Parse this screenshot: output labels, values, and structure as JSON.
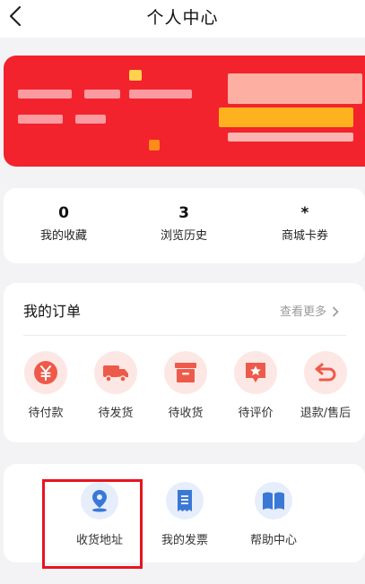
{
  "header": {
    "title": "个人中心"
  },
  "colors": {
    "accent": "#f2232d",
    "order_icon_bg": "#fde7e4",
    "order_icon": "#ee5a4a",
    "tool_icon_bg": "#e6eefb",
    "tool_icon": "#3a78d6"
  },
  "stats": [
    {
      "value": "0",
      "label": "我的收藏"
    },
    {
      "value": "3",
      "label": "浏览历史"
    },
    {
      "value": "*",
      "label": "商城卡券"
    }
  ],
  "orders": {
    "title": "我的订单",
    "more_label": "查看更多",
    "items": [
      {
        "label": "待付款",
        "icon": "yuan-icon"
      },
      {
        "label": "待发货",
        "icon": "truck-icon"
      },
      {
        "label": "待收货",
        "icon": "box-icon"
      },
      {
        "label": "待评价",
        "icon": "star-comment-icon"
      },
      {
        "label": "退款/售后",
        "icon": "return-arrow-icon"
      }
    ]
  },
  "tools": [
    {
      "label": "收货地址",
      "icon": "location-pin-icon"
    },
    {
      "label": "我的发票",
      "icon": "invoice-icon"
    },
    {
      "label": "帮助中心",
      "icon": "book-icon"
    }
  ]
}
